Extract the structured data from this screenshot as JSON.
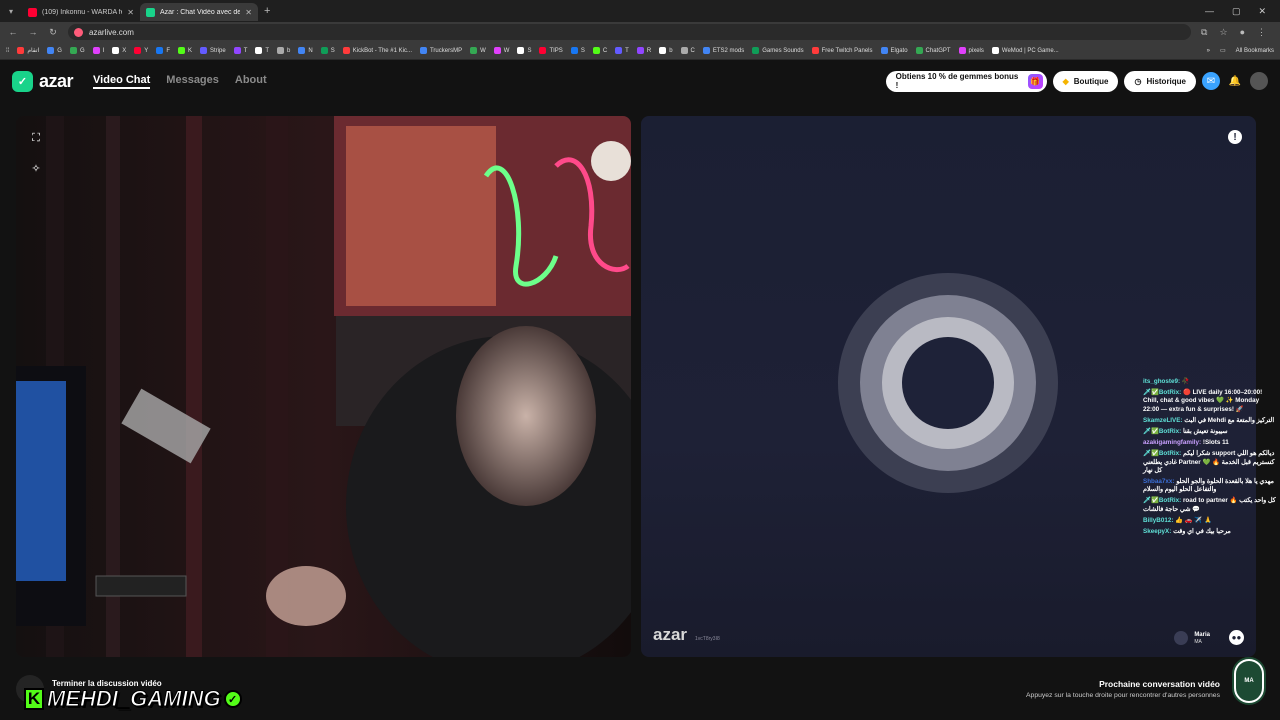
{
  "browser": {
    "tabs": [
      {
        "title": "(109) Inkonnu - WARDA feat M",
        "color": "#ff0033"
      },
      {
        "title": "Azar : Chat Vidéo avec de",
        "color": "#19d38a",
        "active": true
      }
    ],
    "url": "azarlive.com",
    "bookmarks": [
      "اتقام",
      "G",
      "G",
      "I",
      "X",
      "Y",
      "F",
      "K",
      "Stripe",
      "T",
      "T",
      "b",
      "N",
      "S",
      "KickBot - The #1 Kic...",
      "TruckersMP",
      "W",
      "W",
      "S",
      "TIPS",
      "S",
      "C",
      "T",
      "R",
      "b",
      "C",
      "ETS2 mods",
      "Games Sounds",
      "Free Twitch Panels",
      "Elgato",
      "ChatGPT",
      "pixels",
      "WeMod | PC Game..."
    ],
    "all_bookmarks": "All Bookmarks"
  },
  "header": {
    "logo": "azar",
    "nav": [
      "Video Chat",
      "Messages",
      "About"
    ],
    "gems_label": "Obtiens 10 % de gemmes bonus !",
    "shop_label": "Boutique",
    "history_label": "Historique"
  },
  "remote": {
    "watermark": "azar",
    "watermark_id": "1vcT8ry3I8",
    "peer_name": "Maria",
    "peer_country": "MA"
  },
  "chat": [
    {
      "user": "its_ghoste9:",
      "text": "🥀",
      "color": "#5fe0d7"
    },
    {
      "user": "🗡✅BotRix:",
      "text": "🔴 LIVE daily 16:00–20:00! Chill, chat & good vibes 💚 ✨ Monday 22:00 — extra fun & surprises! 🚀",
      "color": "#5fe0d7"
    },
    {
      "user": "SkamzeLIVE:",
      "text": "في البث Mehdi التركيز والمتعة مع",
      "color": "#5fe0d7"
    },
    {
      "user": "🗡✅BotRix:",
      "text": "سيبونة تعيش بقنا",
      "color": "#5fe0d7"
    },
    {
      "user": "azakigamingfamily:",
      "text": "!Slots 11",
      "color": "#c9a0ff"
    },
    {
      "user": "🗡✅BotRix:",
      "text": "شكرا ليكم support ديالكم هو اللي غادي يطلعني Partner 💚 🔥 كنستريم قبل الخدمة كل نهار",
      "color": "#5fe0d7"
    },
    {
      "user": "Shbaa7xx:",
      "text": "مهدي يا هلا بالقعدة الحلوة والجو الحلو والتفاعل الحلو اليوم والسلام",
      "color": "#3b6fd6"
    },
    {
      "user": "🗡✅BotRix:",
      "text": "road to partner 🔥 كل واحد يكتب شي حاجة فالشات 💬",
      "color": "#5fe0d7"
    },
    {
      "user": "BillyB012:",
      "text": "👍 🚗 ✈️ 🙏",
      "color": "#5fe0d7"
    },
    {
      "user": "SkeepyX:",
      "text": "مرحبا بيك في اي وقت",
      "color": "#5fe0d7"
    }
  ],
  "footer": {
    "end_label": "Terminer la discussion vidéo",
    "streamer": "MEHDI_GAMING",
    "next_title": "Prochaine conversation vidéo",
    "next_sub": "Appuyez sur la touche droite pour rencontrer d'autres personnes",
    "corner_logo": "MA"
  },
  "colors": {
    "accent": "#19d38a",
    "kick": "#53fc18"
  }
}
